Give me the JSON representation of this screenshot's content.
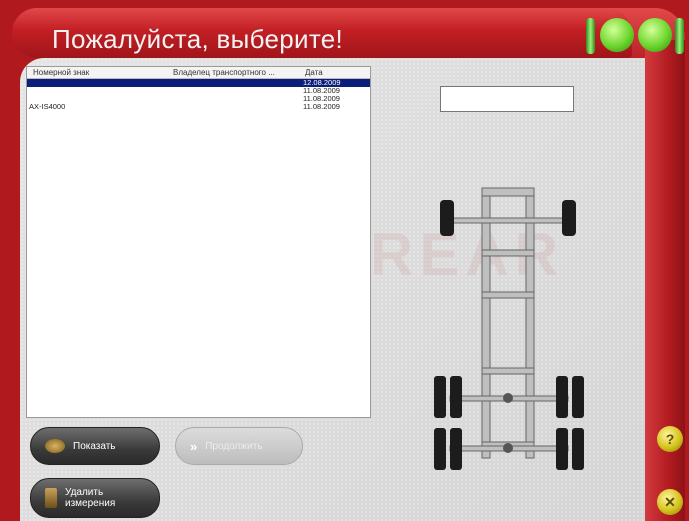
{
  "title": "Пожалуйста, выберите!",
  "list": {
    "columns": [
      "Номерной знак",
      "Владелец транспортного ...",
      "Дата"
    ],
    "rows": [
      {
        "plate": "",
        "owner": "",
        "date": "12.08.2009",
        "selected": true
      },
      {
        "plate": "",
        "owner": "",
        "date": "11.08.2009",
        "selected": false
      },
      {
        "plate": "",
        "owner": "",
        "date": "11.08.2009",
        "selected": false
      },
      {
        "plate": "AX-IS4000",
        "owner": "",
        "date": "11.08.2009",
        "selected": false
      }
    ]
  },
  "plate_field": {
    "value": ""
  },
  "buttons": {
    "show": "Показать",
    "continue": "Продолжить",
    "delete": "Удалить измерения"
  },
  "help_label": "?",
  "close_label": "✕",
  "colors": {
    "frame": "#b01a1e",
    "lamp": "#6cd52c",
    "selection": "#0b1e7a"
  }
}
